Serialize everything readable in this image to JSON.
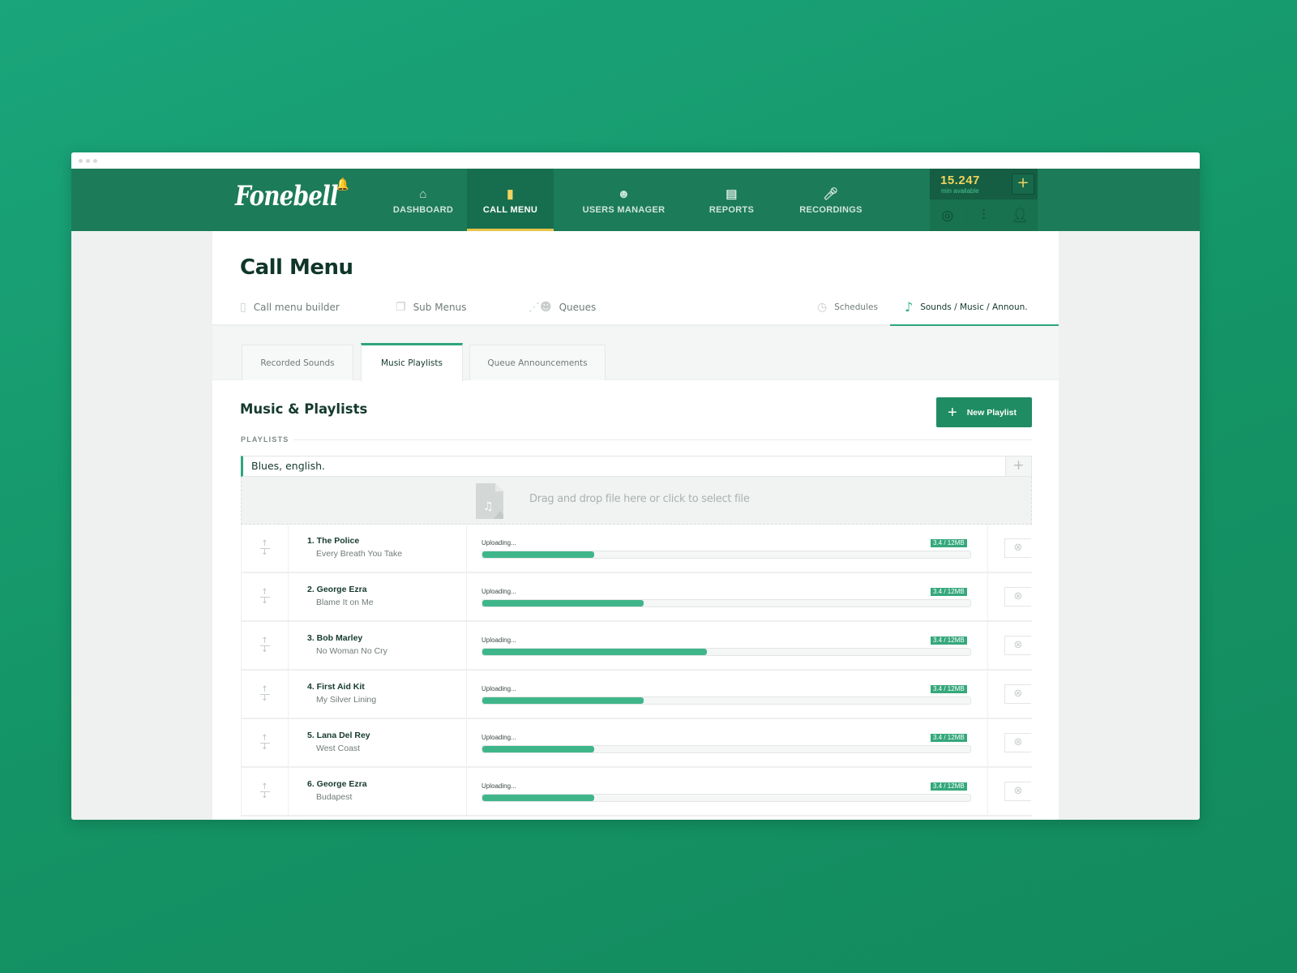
{
  "app": {
    "logo_text": "Fonebell",
    "window_dots": 3
  },
  "nav": {
    "items": [
      {
        "label": "DASHBOARD",
        "icon": "home-icon",
        "glyph": "⌂"
      },
      {
        "label": "CALL MENU",
        "icon": "mobile-phone-icon",
        "glyph": "▯",
        "active": true
      },
      {
        "label": "USERS MANAGER",
        "icon": "users-icon",
        "glyph": "👥"
      },
      {
        "label": "REPORTS",
        "icon": "reports-tray-icon",
        "glyph": "▤"
      },
      {
        "label": "RECORDINGS",
        "icon": "microphone-icon",
        "glyph": "🎙"
      }
    ]
  },
  "account": {
    "minutes_value": "15.247",
    "minutes_label": "min available",
    "add_label": "+",
    "icons": [
      "support-lifebuoy-icon",
      "settings-sliders-icon",
      "user-profile-icon"
    ]
  },
  "page": {
    "title": "Call Menu"
  },
  "subnav": {
    "items": [
      {
        "label": "Call menu builder",
        "icon": "mobile-phone-icon"
      },
      {
        "label": "Sub Menus",
        "icon": "stacked-pages-icon"
      },
      {
        "label": "Queues",
        "icon": "queue-people-icon"
      },
      {
        "label": "Schedules",
        "icon": "clock-icon"
      },
      {
        "label": "Sounds / Music / Announ.",
        "icon": "music-note-icon",
        "active": true
      }
    ]
  },
  "tabs": [
    {
      "label": "Recorded Sounds"
    },
    {
      "label": "Music Playlists",
      "active": true
    },
    {
      "label": "Queue Announcements"
    }
  ],
  "section": {
    "title": "Music & Playlists",
    "new_button": "New Playlist",
    "group_label": "PLAYLISTS"
  },
  "playlist": {
    "name": "Blues, english.",
    "dropzone_text": "Drag and drop file here or click to select file"
  },
  "tracks": [
    {
      "artist": "1. The Police",
      "song": "Every Breath You Take",
      "status": "Uploading...",
      "size": "3.4 / 12MB",
      "progress": 0.23
    },
    {
      "artist": "2. George Ezra",
      "song": "Blame It on Me",
      "status": "Uploading...",
      "size": "3.4 / 12MB",
      "progress": 0.33
    },
    {
      "artist": "3. Bob Marley",
      "song": "No Woman No Cry",
      "status": "Uploading...",
      "size": "3.4 / 12MB",
      "progress": 0.46
    },
    {
      "artist": "4. First Aid Kit",
      "song": "My Silver Lining",
      "status": "Uploading...",
      "size": "3.4 / 12MB",
      "progress": 0.33
    },
    {
      "artist": "5. Lana Del Rey",
      "song": "West Coast",
      "status": "Uploading...",
      "size": "3.4 / 12MB",
      "progress": 0.23
    },
    {
      "artist": "6. George Ezra",
      "song": "Budapest",
      "status": "Uploading...",
      "size": "3.4 / 12MB",
      "progress": 0.23
    }
  ],
  "colors": {
    "brand_green": "#1c7b58",
    "accent_green": "#2fa57a",
    "progress_fill": "#3fb68a",
    "minutes_yellow": "#f2d35c"
  }
}
